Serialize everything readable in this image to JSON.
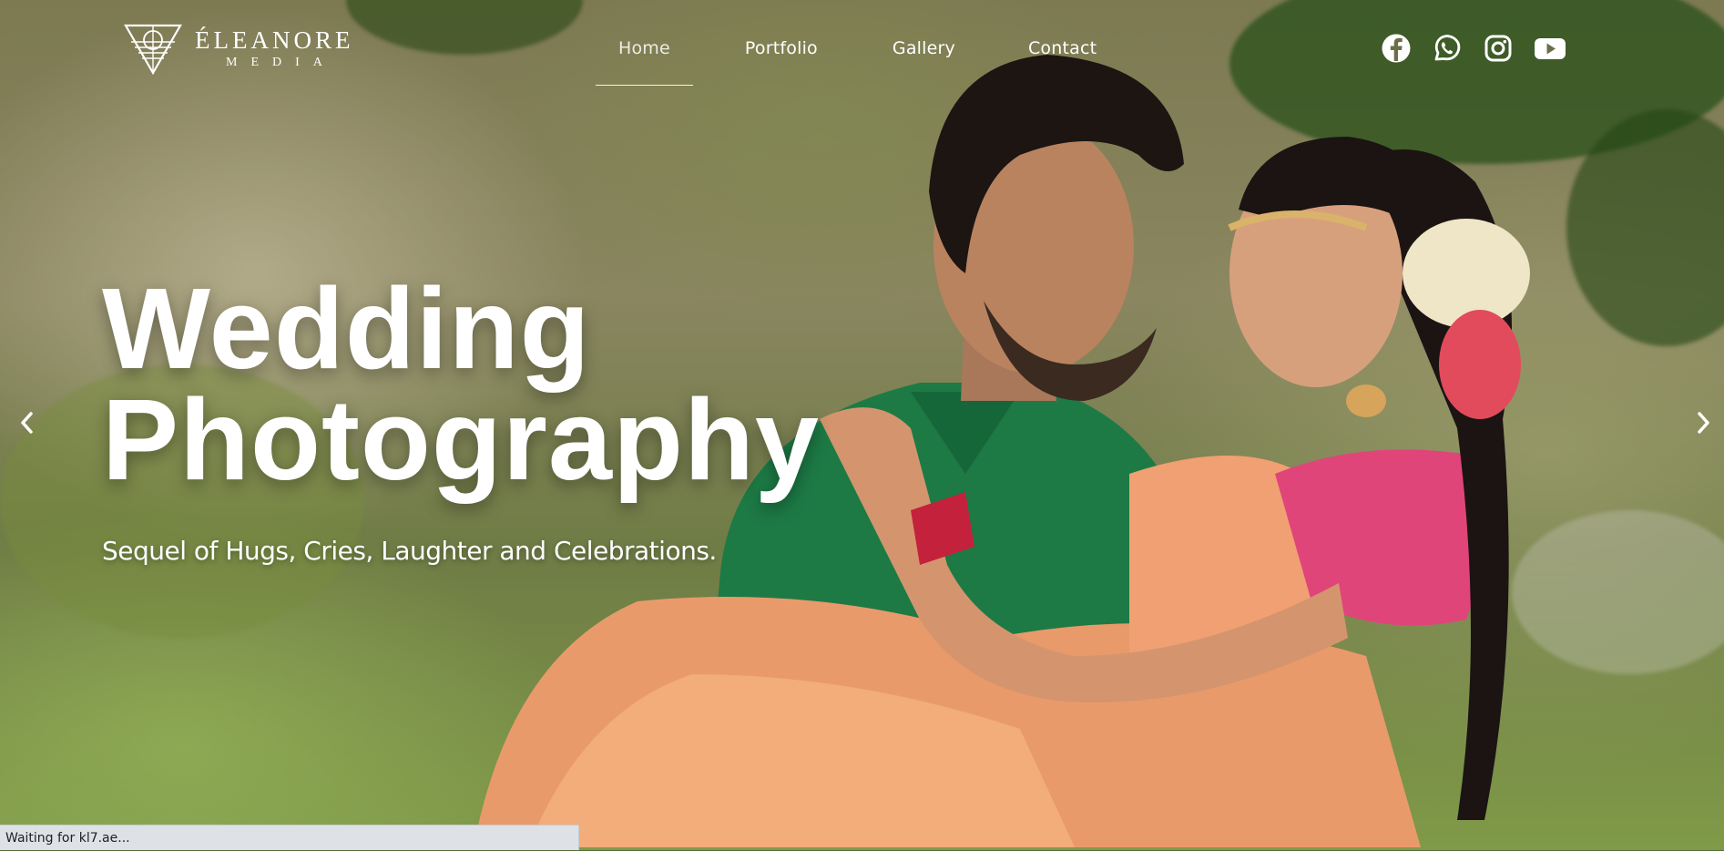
{
  "logo": {
    "name": "ÉLEANORE",
    "sub": "MEDIA"
  },
  "nav": {
    "items": [
      {
        "label": "Home",
        "active": true
      },
      {
        "label": "Portfolio"
      },
      {
        "label": "Gallery"
      },
      {
        "label": "Contact"
      }
    ]
  },
  "social": [
    "facebook-icon",
    "whatsapp-icon",
    "instagram-icon",
    "youtube-icon"
  ],
  "hero": {
    "title_line1": "Wedding",
    "title_line2": "Photography",
    "subtitle": "Sequel of Hugs, Cries, Laughter and Celebrations."
  },
  "carousel": {
    "prev_icon": "chevron-left-icon",
    "next_icon": "chevron-right-icon"
  },
  "status_bar": {
    "text": "Waiting for kl7.ae..."
  },
  "colors": {
    "accent": "#ffffff",
    "status_bg": "#dee1e6"
  }
}
